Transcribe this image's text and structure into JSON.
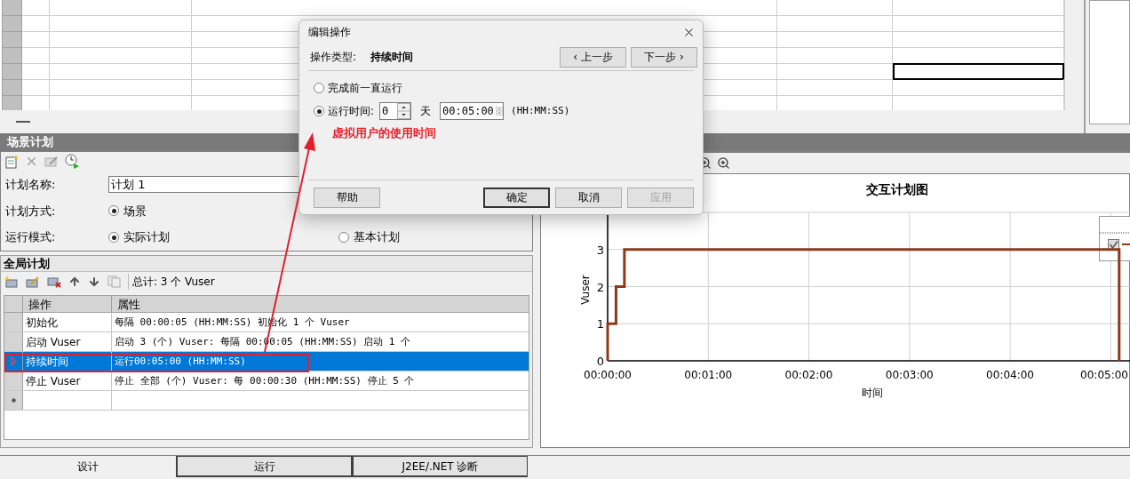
{
  "spreadsheet": {
    "rows": [
      {
        "cells": [
          {
            "selected": false
          },
          {
            "selected": false
          },
          {
            "selected": false
          },
          {
            "selected": false
          },
          {
            "selected": false
          }
        ]
      },
      {
        "cells": [
          {
            "selected": false
          },
          {
            "selected": false
          },
          {
            "selected": false
          },
          {
            "selected": false
          },
          {
            "selected": false
          }
        ]
      },
      {
        "cells": [
          {
            "selected": false
          },
          {
            "selected": false
          },
          {
            "selected": false
          },
          {
            "selected": false
          },
          {
            "selected": false
          }
        ]
      },
      {
        "cells": [
          {
            "selected": false
          },
          {
            "selected": false
          },
          {
            "selected": false
          },
          {
            "selected": false
          },
          {
            "selected": false
          }
        ]
      },
      {
        "cells": [
          {
            "selected": false
          },
          {
            "selected": false
          },
          {
            "selected": false
          },
          {
            "selected": false
          },
          {
            "selected": true
          }
        ]
      },
      {
        "cells": [
          {
            "selected": false
          },
          {
            "selected": false
          },
          {
            "selected": false
          },
          {
            "selected": false
          },
          {
            "selected": false
          }
        ]
      },
      {
        "cells": [
          {
            "selected": false
          },
          {
            "selected": false
          },
          {
            "selected": false
          },
          {
            "selected": false
          },
          {
            "selected": false
          }
        ]
      }
    ]
  },
  "scenario_schedule": {
    "title": "场景计划",
    "fields": [
      {
        "label": "计划名称:",
        "kind": "input",
        "value": "计划 1"
      },
      {
        "label": "计划方式:",
        "kind": "radio",
        "options": [
          {
            "label": "场景",
            "selected": true
          }
        ]
      },
      {
        "label": "运行模式:",
        "kind": "radio",
        "options": [
          {
            "label": "实际计划",
            "selected": true
          },
          {
            "label": "基本计划",
            "selected": false
          }
        ]
      }
    ]
  },
  "global_schedule": {
    "title": "全局计划",
    "total": "总计: 3 个 Vuser",
    "columns": [
      "操作",
      "属性"
    ],
    "rows": [
      {
        "action": "初始化",
        "properties": "每隔 00:00:05 (HH:MM:SS) 初始化 1 个 Vuser",
        "selected": false
      },
      {
        "action": "启动 Vuser",
        "properties": "启动 3 (个) Vuser: 每隔 00:00:05 (HH:MM:SS) 启动 1 个",
        "selected": false
      },
      {
        "action": "持续时间",
        "properties": "运行00:05:00 (HH:MM:SS)",
        "selected": true
      },
      {
        "action": "停止 Vuser",
        "properties": "停止 全部 (个) Vuser: 每 00:00:30 (HH:MM:SS) 停止 5 个",
        "selected": false
      }
    ]
  },
  "chart": {
    "title": "交互计划图",
    "legend": {
      "checked": true
    },
    "chart_data": {
      "type": "line",
      "grid": true,
      "xlabel": "时间",
      "ylabel": "Vuser",
      "x": [
        0,
        0,
        5,
        5,
        10,
        10,
        305,
        305
      ],
      "series": [
        {
          "color": "#8b3a1a",
          "values": [
            0,
            1,
            1,
            2,
            2,
            3,
            3,
            0
          ]
        }
      ],
      "xlim": [
        0,
        312
      ],
      "ylim": [
        0,
        4
      ],
      "xticks": [
        {
          "value": 0,
          "label": "00:00:00"
        },
        {
          "value": 60,
          "label": "00:01:00"
        },
        {
          "value": 120,
          "label": "00:02:00"
        },
        {
          "value": 180,
          "label": "00:03:00"
        },
        {
          "value": 240,
          "label": "00:04:00"
        },
        {
          "value": 300,
          "label": "00:05:00"
        }
      ],
      "yticks": [
        0,
        1,
        2,
        3
      ]
    }
  },
  "bottom_tabs": [
    {
      "label": "设计",
      "selected": true
    },
    {
      "label": "运行",
      "selected": false
    },
    {
      "label": "J2EE/.NET 诊断",
      "selected": false
    }
  ],
  "dialog": {
    "title": "编辑操作",
    "type_label": "操作类型:",
    "type_value": "持续时间",
    "nav_buttons": [
      "‹ 上一步",
      "下一步 ›"
    ],
    "options": [
      {
        "label": "完成前一直运行",
        "selected": false
      },
      {
        "label": "运行时间:",
        "selected": true
      }
    ],
    "days": "0",
    "days_unit": "天",
    "time": "00:05:00",
    "time_format": "(HH:MM:SS)",
    "annotation": "虚拟用户的使用时间",
    "buttons": [
      {
        "label": "帮助",
        "default": false,
        "disabled": false
      },
      {
        "label": "确定",
        "default": true,
        "disabled": false
      },
      {
        "label": "取消",
        "default": false,
        "disabled": false
      },
      {
        "label": "应用",
        "default": false,
        "disabled": true
      }
    ]
  }
}
